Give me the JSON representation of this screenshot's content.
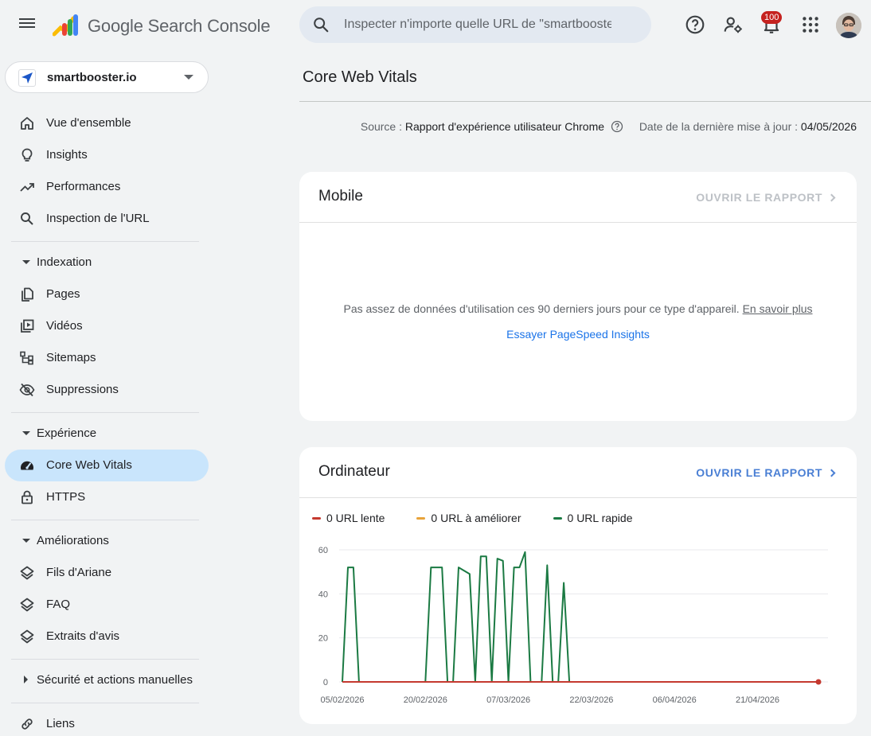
{
  "app": {
    "title": "Google Search Console"
  },
  "search": {
    "placeholder": "Inspecter n'importe quelle URL de \"smartbooster.io\""
  },
  "header": {
    "notifications_count": "100"
  },
  "property": {
    "name": "smartbooster.io"
  },
  "nav": {
    "overview": "Vue d'ensemble",
    "insights": "Insights",
    "performance": "Performances",
    "url_inspection": "Inspection de l'URL",
    "indexing_section": "Indexation",
    "pages": "Pages",
    "videos": "Vidéos",
    "sitemaps": "Sitemaps",
    "removals": "Suppressions",
    "experience_section": "Expérience",
    "core_web_vitals": "Core Web Vitals",
    "https": "HTTPS",
    "enhancements_section": "Améliorations",
    "breadcrumbs": "Fils d'Ariane",
    "faq": "FAQ",
    "review_snippets": "Extraits d'avis",
    "security_section": "Sécurité et actions manuelles",
    "links": "Liens"
  },
  "page": {
    "title": "Core Web Vitals",
    "source_label": "Source :",
    "source_value": "Rapport d'expérience utilisateur Chrome",
    "updated_label": "Date de la dernière mise à jour :",
    "updated_value": "04/05/2026"
  },
  "mobile": {
    "title": "Mobile",
    "open_report": "OUVRIR LE RAPPORT",
    "no_data": "Pas assez de données d'utilisation ces 90 derniers jours pour ce type d'appareil.",
    "learn_more": "En savoir plus",
    "psi_link": "Essayer PageSpeed Insights"
  },
  "desktop": {
    "title": "Ordinateur",
    "open_report": "OUVRIR LE RAPPORT"
  },
  "colors": {
    "slow": "#c5392f",
    "improve": "#e8a33a",
    "fast": "#1b7a43"
  },
  "chart_data": {
    "type": "line",
    "x_start": "2026-02-05",
    "x_end": "2026-05-02",
    "x_ticks": [
      "05/02/2026",
      "20/02/2026",
      "07/03/2026",
      "22/03/2026",
      "06/04/2026",
      "21/04/2026"
    ],
    "y_ticks": [
      0,
      20,
      40,
      60
    ],
    "ylim": [
      0,
      60
    ],
    "series": [
      {
        "name": "0 URL lente",
        "color_key": "slow",
        "values": [
          [
            "2026-02-05",
            0
          ],
          [
            "2026-05-02",
            0
          ]
        ]
      },
      {
        "name": "0 URL à améliorer",
        "color_key": "improve",
        "values": []
      },
      {
        "name": "0 URL rapide",
        "color_key": "fast",
        "values": [
          [
            "2026-02-05",
            0
          ],
          [
            "2026-02-06",
            52
          ],
          [
            "2026-02-07",
            52
          ],
          [
            "2026-02-08",
            0
          ],
          [
            "2026-02-20",
            0
          ],
          [
            "2026-02-21",
            52
          ],
          [
            "2026-02-22",
            52
          ],
          [
            "2026-02-23",
            52
          ],
          [
            "2026-02-24",
            0
          ],
          [
            "2026-02-25",
            0
          ],
          [
            "2026-02-26",
            52
          ],
          [
            "2026-02-28",
            49
          ],
          [
            "2026-03-01",
            0
          ],
          [
            "2026-03-02",
            57
          ],
          [
            "2026-03-03",
            57
          ],
          [
            "2026-03-04",
            0
          ],
          [
            "2026-03-05",
            56
          ],
          [
            "2026-03-06",
            55
          ],
          [
            "2026-03-07",
            0
          ],
          [
            "2026-03-08",
            52
          ],
          [
            "2026-03-09",
            52
          ],
          [
            "2026-03-10",
            59
          ],
          [
            "2026-03-11",
            0
          ],
          [
            "2026-03-13",
            0
          ],
          [
            "2026-03-14",
            53
          ],
          [
            "2026-03-15",
            0
          ],
          [
            "2026-03-16",
            0
          ],
          [
            "2026-03-17",
            45
          ],
          [
            "2026-03-18",
            0
          ]
        ]
      }
    ]
  }
}
